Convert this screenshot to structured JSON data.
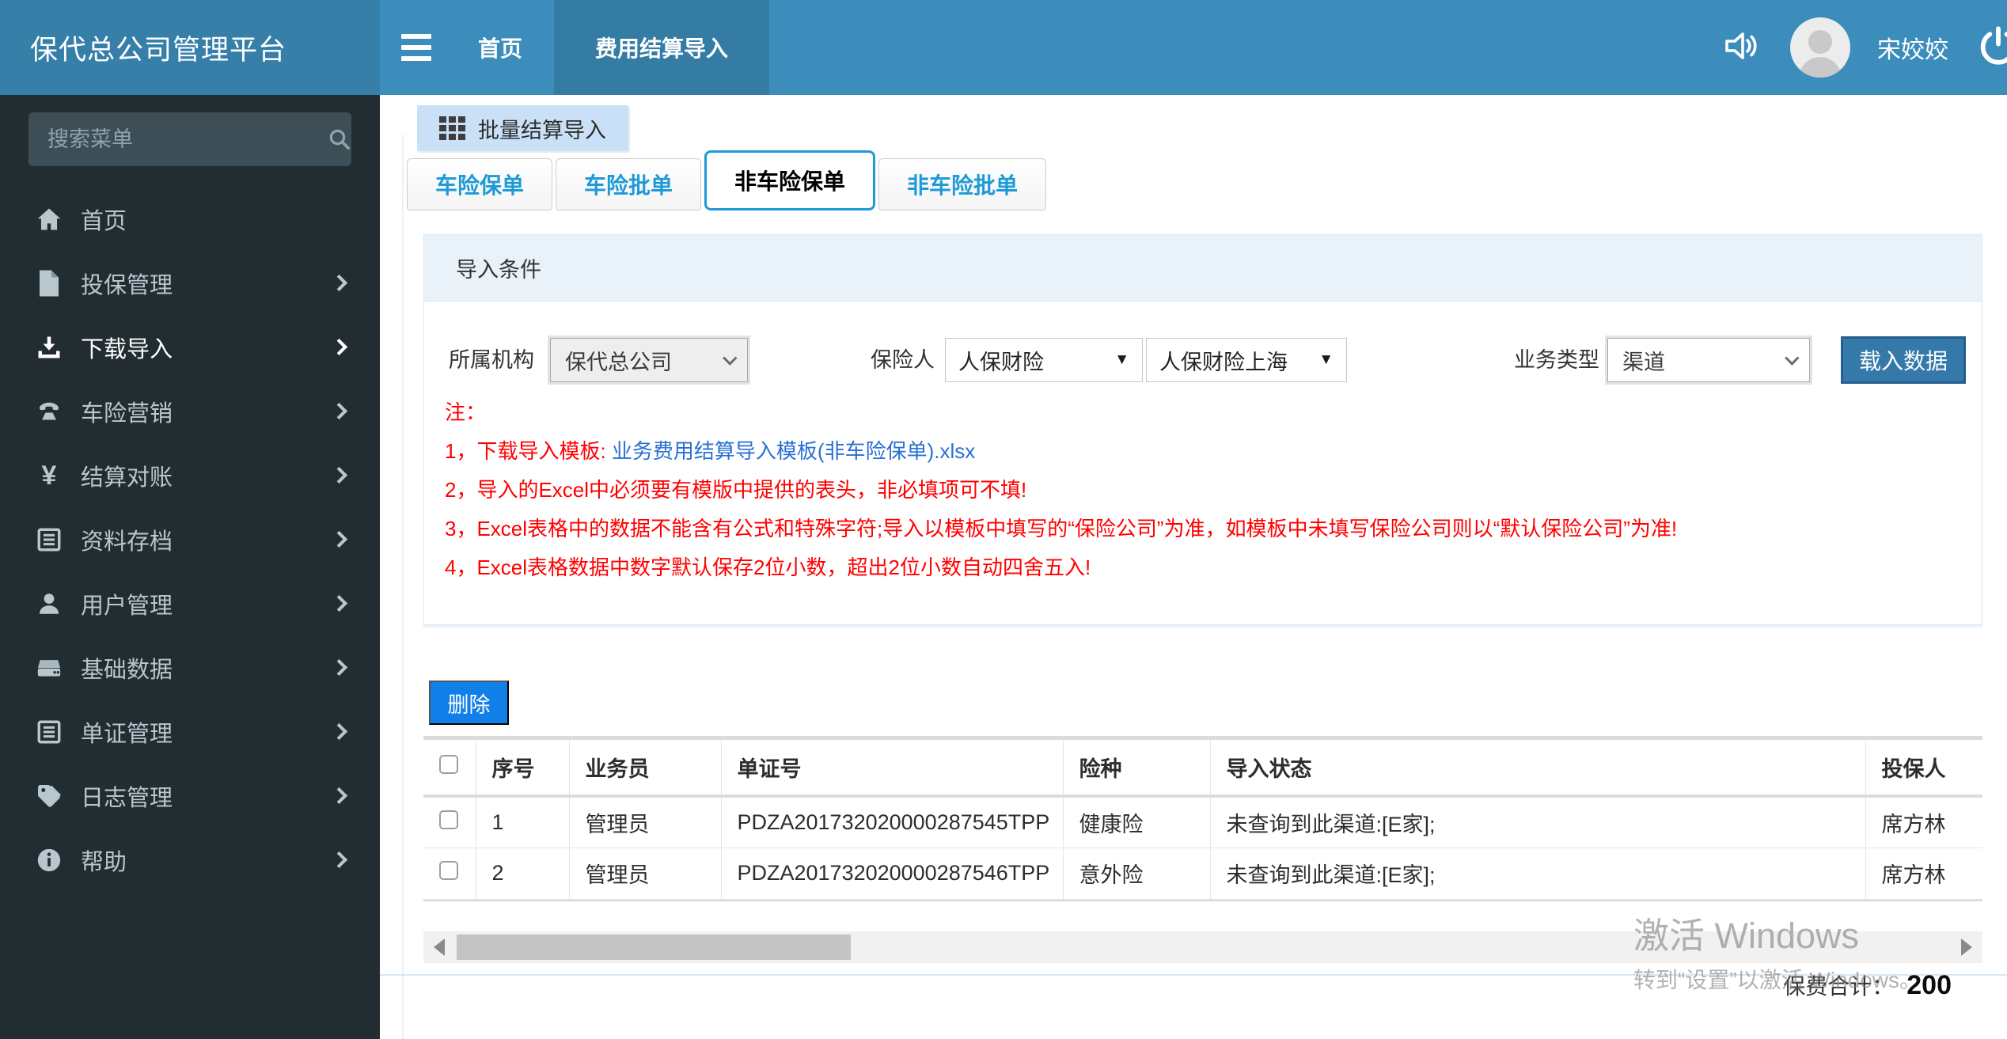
{
  "app": {
    "brand": "保代总公司管理平台"
  },
  "topbar": {
    "nav": [
      {
        "label": "首页",
        "active": false
      },
      {
        "label": "费用结算导入",
        "active": true
      }
    ],
    "username": "宋姣姣"
  },
  "sidebar": {
    "search_placeholder": "搜索菜单",
    "items": [
      {
        "label": "首页",
        "icon": "home-icon",
        "active": false,
        "chevron": false
      },
      {
        "label": "投保管理",
        "icon": "file-icon",
        "active": false,
        "chevron": true
      },
      {
        "label": "下载导入",
        "icon": "download-icon",
        "active": true,
        "chevron": true
      },
      {
        "label": "车险营销",
        "icon": "phone-icon",
        "active": false,
        "chevron": true
      },
      {
        "label": "结算对账",
        "icon": "yen-icon",
        "active": false,
        "chevron": true
      },
      {
        "label": "资料存档",
        "icon": "list-icon",
        "active": false,
        "chevron": true
      },
      {
        "label": "用户管理",
        "icon": "user-icon",
        "active": false,
        "chevron": true
      },
      {
        "label": "基础数据",
        "icon": "hdd-icon",
        "active": false,
        "chevron": true
      },
      {
        "label": "单证管理",
        "icon": "list-icon",
        "active": false,
        "chevron": true
      },
      {
        "label": "日志管理",
        "icon": "tags-icon",
        "active": false,
        "chevron": true
      },
      {
        "label": "帮助",
        "icon": "info-icon",
        "active": false,
        "chevron": true
      }
    ]
  },
  "breadcrumb": {
    "label": "批量结算导入"
  },
  "tabs": [
    {
      "label": "车险保单",
      "active": false
    },
    {
      "label": "车险批单",
      "active": false
    },
    {
      "label": "非车险保单",
      "active": true
    },
    {
      "label": "非车险批单",
      "active": false
    }
  ],
  "filter_panel": {
    "title": "导入条件",
    "org_label": "所属机构",
    "org_value": "保代总公司",
    "insurer_label": "保险人",
    "insurer_value_1": "人保财险",
    "insurer_value_2": "人保财险上海",
    "biz_label": "业务类型",
    "biz_value": "渠道",
    "load_button": "载入数据"
  },
  "notes": {
    "heading": "注：",
    "line1_prefix": "1，下载导入模板: ",
    "line1_link": "业务费用结算导入模板(非车险保单).xlsx",
    "lines": [
      "2，导入的Excel中必须要有模版中提供的表头，非必填项可不填!",
      "3，Excel表格中的数据不能含有公式和特殊字符;导入以模板中填写的“保险公司”为准，如模板中未填写保险公司则以“默认保险公司”为准!",
      "4，Excel表格数据中数字默认保存2位小数，超出2位小数自动四舍五入!"
    ]
  },
  "table": {
    "delete_button": "删除",
    "columns": [
      "序号",
      "业务员",
      "单证号",
      "险种",
      "导入状态",
      "投保人"
    ],
    "rows": [
      {
        "seq": "1",
        "agent": "管理员",
        "doc_no": "PDZA201732020000287545TPP",
        "insurance_type": "健康险",
        "import_status": "未查询到此渠道:[E家];",
        "policy_holder": "席方林"
      },
      {
        "seq": "2",
        "agent": "管理员",
        "doc_no": "PDZA201732020000287546TPP",
        "insurance_type": "意外险",
        "import_status": "未查询到此渠道:[E家];",
        "policy_holder": "席方林"
      }
    ]
  },
  "footer": {
    "total_label": "保费合计：",
    "total_value": "200"
  },
  "watermark": {
    "line1": "激活 Windows",
    "line2": "转到“设置”以激活 Windows。"
  },
  "colors": {
    "navbar": "#3c8dbc",
    "navbar_active": "#357ca5",
    "brand_bg": "#367fa9",
    "sidebar_bg": "#222d32",
    "sidebar_text": "#b8c7ce",
    "tab_blue": "#1e9ad7",
    "panel_head_bg": "#e9f1f9",
    "delete_button_bg": "#1080e8",
    "load_button_bg": "#3579ab",
    "note_red": "#ff0000",
    "link_blue": "#2a6fd4"
  }
}
